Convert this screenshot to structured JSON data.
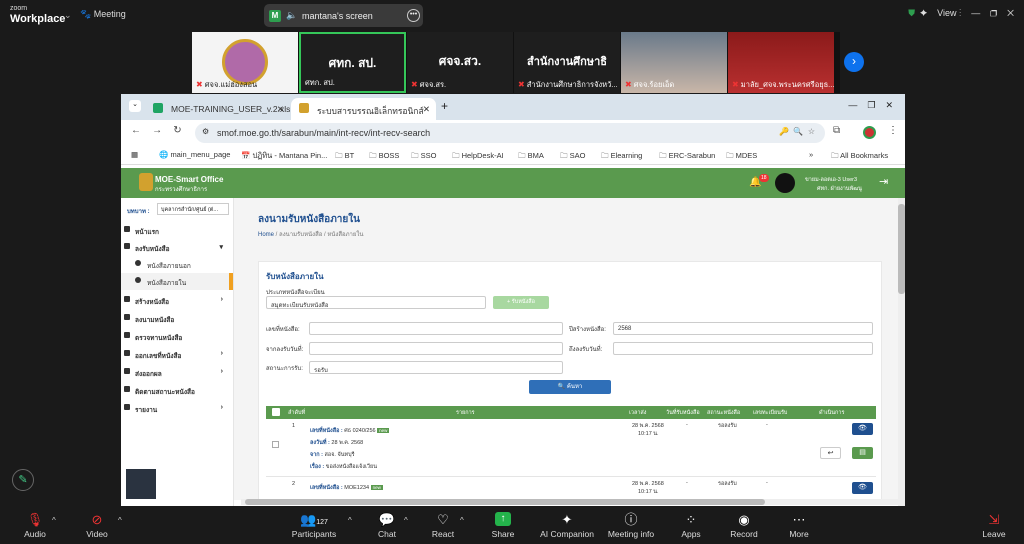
{
  "zoom": {
    "logo_line1": "zoom",
    "logo_line2": "Workplace",
    "meeting_label": "Meeting",
    "share_badge": "M",
    "share_title": "mantana's screen",
    "view_label": "View",
    "participants": [
      {
        "name": "ศจจ.แม่ฮ่องสอน",
        "big": ""
      },
      {
        "name": "ศทก. สป.",
        "big": "ศทก. สป."
      },
      {
        "name": "ศจจ.สร.",
        "big": "ศจจ.สว."
      },
      {
        "name": "สำนักงานศึกษาธิการจังหวั...",
        "big": "สำนักงานศึกษาธิ"
      },
      {
        "name": "ศจจ.ร้อยเอ็ด",
        "big": ""
      },
      {
        "name": "มาลัย_ศจจ.พระนครศรีอยุธ...",
        "big": ""
      }
    ],
    "bottom": {
      "audio": "Audio",
      "video": "Video",
      "participants": "Participants",
      "participants_count": "127",
      "chat": "Chat",
      "react": "React",
      "share": "Share",
      "ai": "AI Companion",
      "info": "Meeting info",
      "apps": "Apps",
      "record": "Record",
      "more": "More",
      "leave": "Leave"
    }
  },
  "browser": {
    "tabs": [
      {
        "label": "MOE-TRAINING_USER_v.2.xlsx"
      },
      {
        "label": "ระบบสารบรรณอิเล็กทรอนิกส์"
      }
    ],
    "url": "smof.moe.go.th/sarabun/main/int-recv/int-recv-search",
    "bookmarks": [
      "main_menu_page",
      "ปฏิทิน - Mantana Pin...",
      "BT",
      "BOSS",
      "SSO",
      "HelpDesk-AI",
      "BMA",
      "SAO",
      "Elearning",
      "ERC-Sarabun",
      "MDES"
    ],
    "all_bookmarks": "All Bookmarks"
  },
  "app": {
    "brand": "MOE-Smart Office",
    "brand_sub": "กระทรวงศึกษาธิการ",
    "notif_count": "18",
    "user_line1": "ขายม-ลอตเอ-3 User3",
    "user_line2": "ศทก. ฝ่ายงานพัฒนู",
    "sidebar_sel_label": "บทบาท :",
    "sidebar_sel_value": "บุคลากรสำนัก/ศูนย์ (ต่...",
    "sidebar": [
      "หน้าแรก",
      "ลงรับหนังสือ",
      "หนังสือภายนอก",
      "หนังสือภายใน",
      "สร้างหนังสือ",
      "ลงนามหนังสือ",
      "ตรวจทานหนังสือ",
      "ออกเลขที่หนังสือ",
      "ส่งออกผล",
      "ติดตามสถานะหนังสือ",
      "รายงาน"
    ],
    "page_title": "ลงนามรับหนังสือภายใน",
    "breadcrumb_home": "Home",
    "breadcrumb_rest": " / ลงนามรับหนังสือ / หนังสือภายใน",
    "card_title": "รับหนังสือภายใน",
    "type_label": "ประเภทหนังสือจะเบียน",
    "type_value": "สมุดทะเบียนรับหนังสือ",
    "add_btn": "+ รับหนังสือ",
    "f_docno": "เลขที่หนังสือ:",
    "f_year": "ปีสร้างหนังสือ:",
    "f_year_val": "2568",
    "f_from": "จากลงรับวันที่:",
    "f_to": "ถึงลงรับวันที่:",
    "f_status": "สถานะการรับ:",
    "f_status_val": "รอรับ",
    "search_btn": "ค้นหา",
    "cols": [
      "ลำดับที่",
      "รายการ",
      "เวลาส่ง",
      "วันที่รับหนังสือ",
      "สถานะหนังสือ",
      "เลขทะเบียนรับ",
      "ดำเนินการ"
    ],
    "rows": [
      {
        "no": "1",
        "docno_l": "เลขที่หนังสือ :",
        "docno": "ศธ 0240/256",
        "date_l": "ลงวันที่ :",
        "date": "28 พ.ค. 2568",
        "from_l": "จาก :",
        "from": "สอจ. จันทบุรี",
        "subj_l": "เรื่อง :",
        "subj": "ขอส่งหนังสือแจ้งเวียน",
        "sent": "28 พ.ค. 2568",
        "sent_t": "10:17 น.",
        "recv": "-",
        "status": "รอลงรับ",
        "regno": "-",
        "badge": "new"
      },
      {
        "no": "2",
        "docno_l": "เลขที่หนังสือ :",
        "docno": "MOE1234",
        "date_l": "",
        "date": "",
        "from_l": "",
        "from": "",
        "subj_l": "",
        "subj": "",
        "sent": "28 พ.ค. 2568",
        "sent_t": "10:17 น.",
        "recv": "-",
        "status": "รอลงรับ",
        "regno": "-",
        "badge": "new"
      }
    ]
  }
}
